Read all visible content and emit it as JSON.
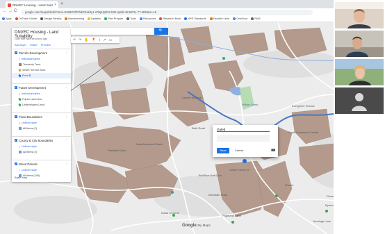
{
  "browser": {
    "tab_title": "DNVEC Housing - Land Suitability",
    "tab_close": "×",
    "new_tab": "+",
    "nav": {
      "back": "←",
      "forward": "→",
      "reload": "C",
      "lock": "🔒"
    },
    "url": "google.com/maps/d/edit?mid=1K5BOVfPrhdGDxk0y1-cRbj4QdN3-kzB-4p&ll=38.6876,-77.5836&z=15",
    "bookmarks": [
      {
        "label": "Apps",
        "color": "#4285f4"
      },
      {
        "label": "OnTrack Online",
        "color": "#ea4335"
      },
      {
        "label": "Design Weekly",
        "color": "#555555"
      },
      {
        "label": "Barnstorming",
        "color": "#e37400"
      },
      {
        "label": "Updates",
        "color": "#fbbc04"
      },
      {
        "label": "Plan Prepare",
        "color": "#34a853"
      },
      {
        "label": "Tools",
        "color": "#5f6368"
      },
      {
        "label": "Resources",
        "color": "#4285f4"
      },
      {
        "label": "Research Book",
        "color": "#ea4335"
      },
      {
        "label": "NRS Standards",
        "color": "#1a73e8"
      },
      {
        "label": "Favorite Links",
        "color": "#e37400"
      },
      {
        "label": "OneDrive",
        "color": "#4285f4"
      },
      {
        "label": "RMS",
        "color": "#5f6368"
      }
    ]
  },
  "panel": {
    "title": "DNVEC Housing - Land Suitability",
    "subtitle": "Last edit was seconds ago",
    "actions": [
      "Add layer",
      "Share",
      "Preview"
    ],
    "layers": [
      {
        "name": "Parcels Development",
        "rows": [
          {
            "label": "Individual styles",
            "type": "style",
            "color": "#1a73e8"
          },
          {
            "label": "Township Tract",
            "type": "swatch",
            "color": "#a07868"
          },
          {
            "label": "Sewer Service Area",
            "type": "pin",
            "color": "#e8a020"
          },
          {
            "label": "Point B",
            "type": "pin",
            "color": "#1a73e8",
            "selected": true
          }
        ]
      },
      {
        "name": "Future Development",
        "rows": [
          {
            "label": "Individual styles",
            "type": "style",
            "color": "#1a73e8"
          },
          {
            "label": "Future Land Use",
            "type": "pin",
            "color": "#34a853"
          },
          {
            "label": "Undeveloped Land",
            "type": "pin",
            "color": "#34a853"
          }
        ]
      },
      {
        "name": "Flood Boundaries",
        "rows": [
          {
            "label": "Uniform style",
            "type": "style",
            "color": "#1a73e8"
          },
          {
            "label": "All items (2)",
            "type": "swatch",
            "color": "#6a9bd8"
          }
        ]
      },
      {
        "name": "County & City Boundaries",
        "rows": [
          {
            "label": "Uniform style",
            "type": "style",
            "color": "#1a73e8"
          },
          {
            "label": "All items (2)",
            "type": "swatch",
            "color": "#6a9bd8"
          }
        ]
      },
      {
        "name": "Wood Parcels",
        "rows": [
          {
            "label": "Uniform style",
            "type": "style",
            "color": "#1a73e8"
          },
          {
            "label": "All items (245)",
            "type": "swatch",
            "color": "#6a9bd8"
          }
        ]
      }
    ],
    "base_map": "Base map"
  },
  "toolbar": {
    "search_icon": "🔍",
    "tools": [
      "↶",
      "↷",
      "✋",
      "📍",
      "⌇",
      "↗",
      "▭"
    ]
  },
  "dialog": {
    "title_value": "Gated",
    "save": "Save",
    "cancel": "Cancel",
    "camera_icon": "📷"
  },
  "map_labels": [
    {
      "text": "Parkside Drive",
      "blue": false
    },
    {
      "text": "Saint Andrews Church",
      "blue": false
    },
    {
      "text": "Laurel Hill Lane",
      "blue": false
    },
    {
      "text": "Bath Road",
      "blue": false
    },
    {
      "text": "Willow Creek",
      "blue": true
    },
    {
      "text": "Cedar Forest Ct",
      "blue": false
    },
    {
      "text": "Pond Commerce Center",
      "blue": false
    },
    {
      "text": "Sheetz",
      "blue": false
    },
    {
      "text": "Dollar General",
      "blue": false
    },
    {
      "text": "Mountain Road",
      "blue": false
    },
    {
      "text": "Pageland Lane",
      "blue": false
    },
    {
      "text": "Ryan's Auto Body",
      "blue": false
    },
    {
      "text": "Jennings Lane",
      "blue": false
    },
    {
      "text": "Pleasant Valley Park",
      "blue": false
    },
    {
      "text": "Bull Run Golf Club",
      "blue": false
    },
    {
      "text": "Evergreen Terrace",
      "blue": false
    }
  ],
  "footer": {
    "google": "Google",
    "my_maps": "My Maps",
    "attribution": "Map data ©2020",
    "zoom_in": "+",
    "zoom_out": "−"
  },
  "colors": {
    "parcel": "#b39a8c",
    "river": "#4a78c0",
    "accent": "#1a73e8"
  },
  "video_tiles": [
    "participant-1",
    "participant-2",
    "participant-3",
    "participant-4"
  ]
}
